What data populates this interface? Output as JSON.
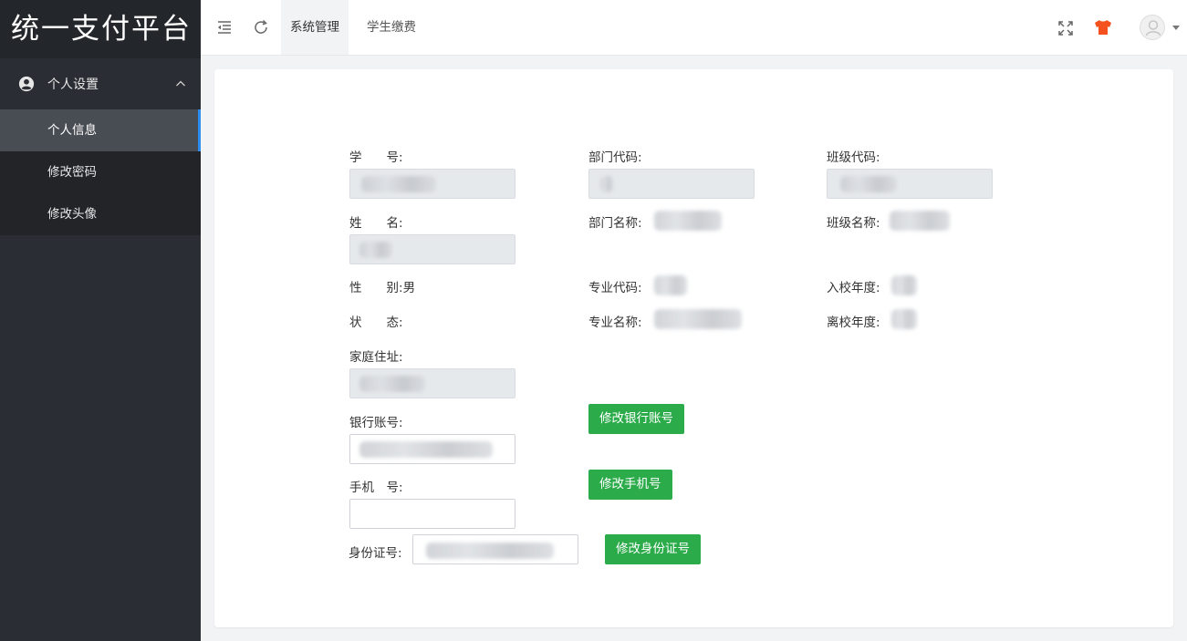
{
  "app": {
    "title": "统一支付平台"
  },
  "sidebar": {
    "group_label": "个人设置",
    "items": [
      {
        "label": "个人信息",
        "active": true
      },
      {
        "label": "修改密码"
      },
      {
        "label": "修改头像"
      }
    ]
  },
  "header": {
    "tabs": [
      {
        "label": "系统管理",
        "active": true
      },
      {
        "label": "学生缴费"
      }
    ],
    "icons": [
      "menu-fold-icon",
      "refresh-icon",
      "fullscreen-icon",
      "theme-shirt-icon",
      "avatar",
      "caret-down-icon"
    ]
  },
  "form": {
    "student_id_label": "学　　号:",
    "dept_code_label": "部门代码:",
    "class_code_label": "班级代码:",
    "name_label": "姓　　名:",
    "dept_name_label": "部门名称:",
    "class_name_label": "班级名称:",
    "gender_label": "性　　别:",
    "gender_value": "男",
    "major_code_label": "专业代码:",
    "enroll_year_label": "入校年度:",
    "status_label": "状　　态:",
    "major_name_label": "专业名称:",
    "leave_year_label": "离校年度:",
    "address_label": "家庭住址:",
    "bank_label": "银行账号:",
    "bank_button": "修改银行账号",
    "phone_label": "手机　号:",
    "phone_button": "修改手机号",
    "idcard_label": "身份证号:",
    "idcard_button": "修改身份证号"
  },
  "colors": {
    "accent": "#2d8cf0",
    "button_green": "#2bab4a",
    "sidebar_bg": "#2a2d33",
    "theme_icon": "#f4511e"
  }
}
